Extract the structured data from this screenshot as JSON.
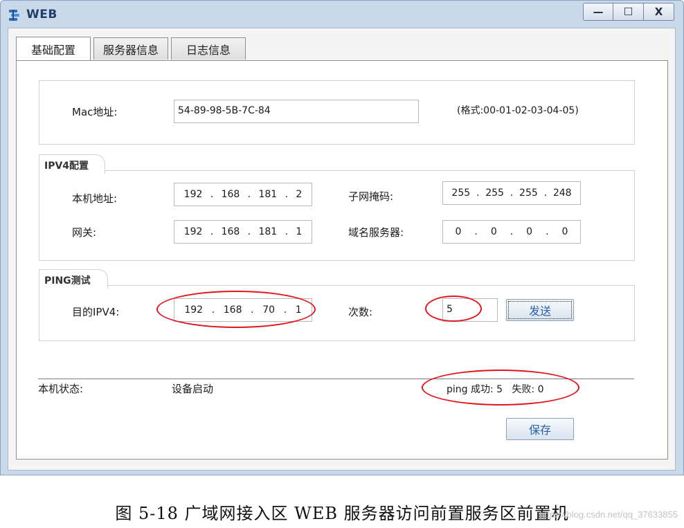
{
  "window": {
    "title": "WEB",
    "buttons": {
      "minimize": "—",
      "maximize": "☐",
      "close": "X"
    }
  },
  "tabs": [
    {
      "label": "基础配置",
      "active": true
    },
    {
      "label": "服务器信息",
      "active": false
    },
    {
      "label": "日志信息",
      "active": false
    }
  ],
  "mac": {
    "label": "Mac地址:",
    "value": "54-89-98-5B-7C-84",
    "format_hint": "(格式:00-01-02-03-04-05)"
  },
  "ipv4": {
    "group_title": "IPV4配置",
    "local_address": {
      "label": "本机地址:",
      "octets": [
        "192",
        "168",
        "181",
        "2"
      ]
    },
    "subnet_mask": {
      "label": "子网掩码:",
      "octets": [
        "255",
        "255",
        "255",
        "248"
      ]
    },
    "gateway": {
      "label": "网关:",
      "octets": [
        "192",
        "168",
        "181",
        "1"
      ]
    },
    "dns": {
      "label": "域名服务器:",
      "octets": [
        "0",
        "0",
        "0",
        "0"
      ]
    }
  },
  "ping": {
    "group_title": "PING测试",
    "dest": {
      "label": "目的IPV4:",
      "octets": [
        "192",
        "168",
        "70",
        "1"
      ]
    },
    "count": {
      "label": "次数:",
      "value": "5"
    },
    "send_button": "发送"
  },
  "status": {
    "label": "本机状态:",
    "value": "设备启动",
    "ping_result": "ping 成功: 5   失败: 0"
  },
  "save_button": "保存",
  "caption": "图 5-18 广域网接入区 WEB 服务器访问前置服务区前置机",
  "watermark": "https://blog.csdn.net/qq_37633855",
  "colors": {
    "annotation": "#e0161c",
    "accent": "#2a5fa8"
  }
}
